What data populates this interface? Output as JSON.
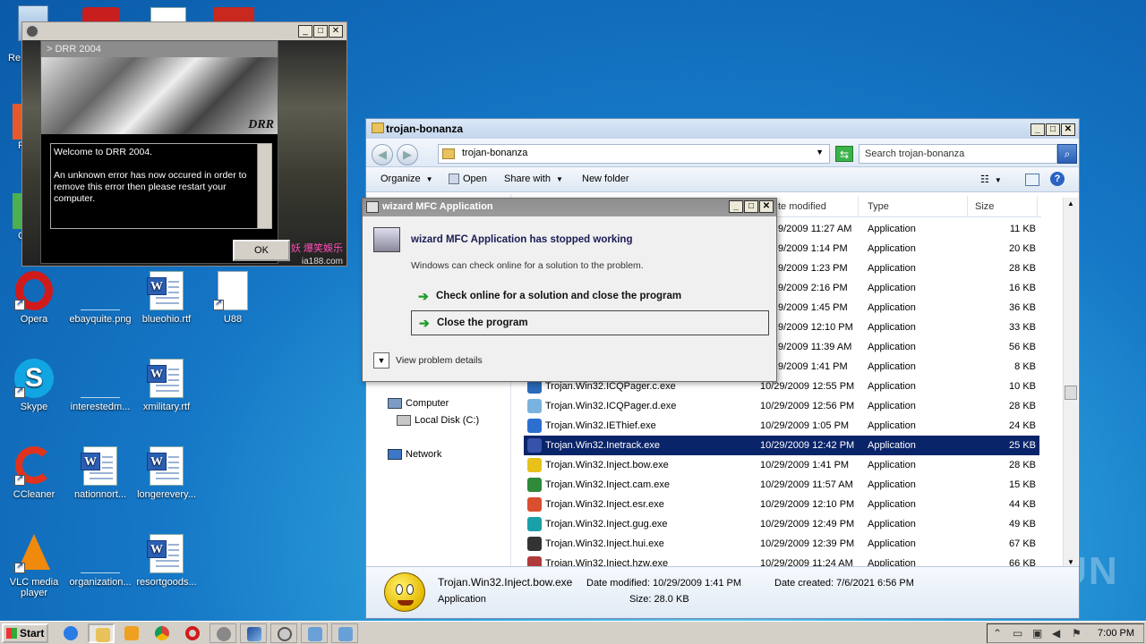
{
  "desktop": {
    "icons": [
      {
        "label": "Opera"
      },
      {
        "label": "ebayquite.png"
      },
      {
        "label": "blueohio.rtf"
      },
      {
        "label": "U88"
      },
      {
        "label": "Skype"
      },
      {
        "label": "interestedm..."
      },
      {
        "label": "xmilitary.rtf"
      },
      {
        "label": "CCleaner"
      },
      {
        "label": "nationnort..."
      },
      {
        "label": "longerevery..."
      },
      {
        "label": "VLC media player"
      },
      {
        "label": "organization..."
      },
      {
        "label": "resortgoods..."
      }
    ],
    "partial_labels": [
      "Re",
      "F",
      "C"
    ]
  },
  "drr": {
    "header": "> DRR 2004",
    "logo": "DRR",
    "message_lines": [
      "Welcome to DRR 2004.",
      "",
      "An unknown error has now occured in order to",
      "remove this error then please restart your computer."
    ],
    "ok_label": "OK",
    "chinese_text": "妖 爆笑娛乐",
    "url_fragment": "ia188.com"
  },
  "explorer": {
    "title": "trojan-bonanza",
    "address": "trojan-bonanza",
    "search_placeholder": "Search trojan-bonanza",
    "toolbar": {
      "organize": "Organize",
      "open": "Open",
      "share_with": "Share with",
      "new_folder": "New folder"
    },
    "columns": {
      "date": "te modified",
      "type": "Type",
      "size": "Size"
    },
    "nav": {
      "computer": "Computer",
      "local_disk": "Local Disk (C:)",
      "network": "Network"
    },
    "rows": [
      {
        "name": "",
        "date": "9/2009 11:27 AM",
        "type": "Application",
        "size": "11 KB",
        "color": ""
      },
      {
        "name": "",
        "date": "9/2009 1:14 PM",
        "type": "Application",
        "size": "20 KB",
        "color": ""
      },
      {
        "name": "",
        "date": "9/2009 1:23 PM",
        "type": "Application",
        "size": "28 KB",
        "color": ""
      },
      {
        "name": "",
        "date": "9/2009 2:16 PM",
        "type": "Application",
        "size": "16 KB",
        "color": ""
      },
      {
        "name": "",
        "date": "9/2009 1:45 PM",
        "type": "Application",
        "size": "36 KB",
        "color": ""
      },
      {
        "name": "",
        "date": "9/2009 12:10 PM",
        "type": "Application",
        "size": "33 KB",
        "color": ""
      },
      {
        "name": "",
        "date": "9/2009 11:39 AM",
        "type": "Application",
        "size": "56 KB",
        "color": ""
      },
      {
        "name": "",
        "date": "9/2009 1:41 PM",
        "type": "Application",
        "size": "8 KB",
        "color": ""
      },
      {
        "name": "Trojan.Win32.ICQPager.c.exe",
        "date": "10/29/2009 12:55 PM",
        "type": "Application",
        "size": "10 KB",
        "color": "#2a6ab8"
      },
      {
        "name": "Trojan.Win32.ICQPager.d.exe",
        "date": "10/29/2009 12:56 PM",
        "type": "Application",
        "size": "28 KB",
        "color": "#7bb3e0"
      },
      {
        "name": "Trojan.Win32.IEThief.exe",
        "date": "10/29/2009 1:05 PM",
        "type": "Application",
        "size": "24 KB",
        "color": "#2d6fcf"
      },
      {
        "name": "Trojan.Win32.Inetrack.exe",
        "date": "10/29/2009 12:42 PM",
        "type": "Application",
        "size": "25 KB",
        "color": "#3553a8"
      },
      {
        "name": "Trojan.Win32.Inject.bow.exe",
        "date": "10/29/2009 1:41 PM",
        "type": "Application",
        "size": "28 KB",
        "color": "#e8c21a"
      },
      {
        "name": "Trojan.Win32.Inject.cam.exe",
        "date": "10/29/2009 11:57 AM",
        "type": "Application",
        "size": "15 KB",
        "color": "#2f8a3a"
      },
      {
        "name": "Trojan.Win32.Inject.esr.exe",
        "date": "10/29/2009 12:10 PM",
        "type": "Application",
        "size": "44 KB",
        "color": "#d94f2f"
      },
      {
        "name": "Trojan.Win32.Inject.gug.exe",
        "date": "10/29/2009 12:49 PM",
        "type": "Application",
        "size": "49 KB",
        "color": "#1aa0a8"
      },
      {
        "name": "Trojan.Win32.Inject.hui.exe",
        "date": "10/29/2009 12:39 PM",
        "type": "Application",
        "size": "67 KB",
        "color": "#333333"
      },
      {
        "name": "Trojan.Win32.Inject.hzw.exe",
        "date": "10/29/2009 11:24 AM",
        "type": "Application",
        "size": "66 KB",
        "color": "#b03a3a"
      }
    ],
    "selected_index": 11,
    "details": {
      "name": "Trojan.Win32.Inject.bow.exe",
      "type": "Application",
      "date_modified": "Date modified: 10/29/2009 1:41 PM",
      "size": "Size: 28.0 KB",
      "date_created": "Date created: 7/6/2021 6:56 PM"
    }
  },
  "wizard": {
    "title": "wizard MFC Application",
    "heading": "wizard MFC Application has stopped working",
    "sub": "Windows can check online for a solution to the problem.",
    "option_check": "Check online for a solution and close the program",
    "option_close": "Close the program",
    "details": "View problem details"
  },
  "taskbar": {
    "start": "Start",
    "clock": "7:00 PM"
  },
  "watermark": "ANY RUN"
}
